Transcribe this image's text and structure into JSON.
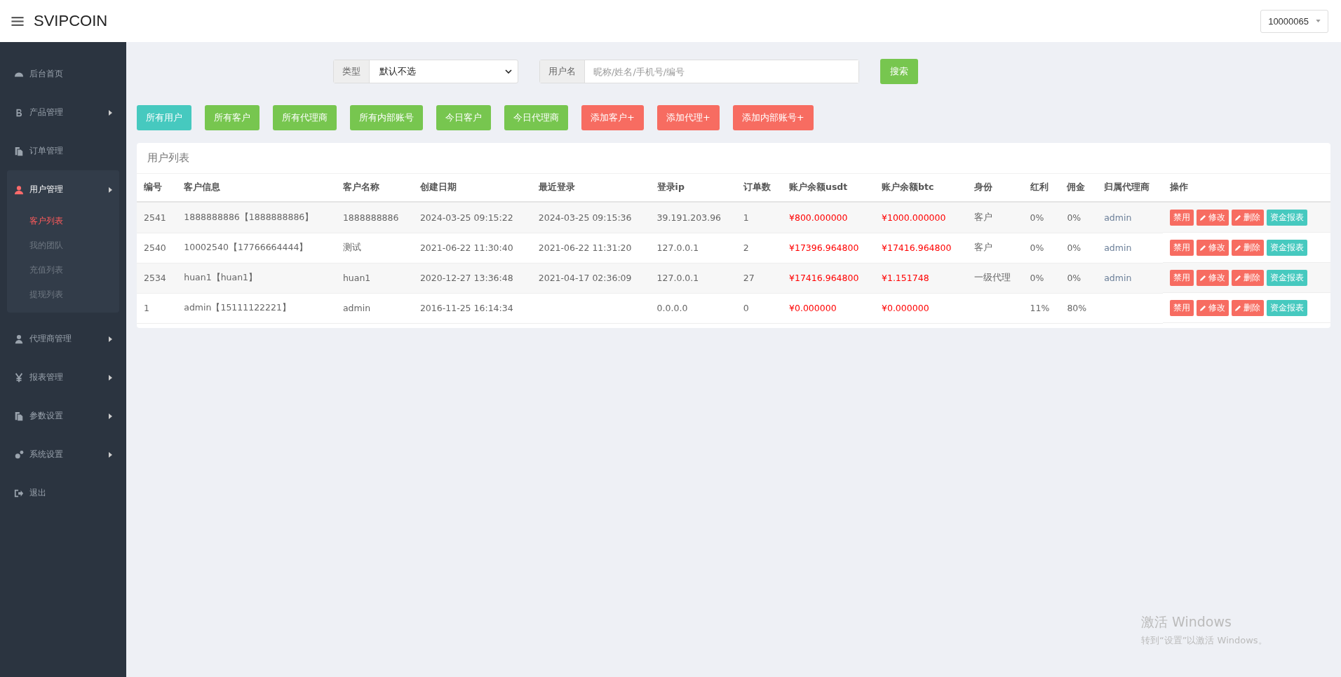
{
  "header": {
    "brand": "SVIPCOIN",
    "account": "10000065"
  },
  "sidebar": {
    "items": [
      {
        "label": "后台首页",
        "arrow": false,
        "selected": false
      },
      {
        "label": "产品管理",
        "arrow": true,
        "selected": false
      },
      {
        "label": "订单管理",
        "arrow": false,
        "selected": false
      },
      {
        "label": "用户管理",
        "arrow": true,
        "selected": true,
        "children": [
          {
            "label": "客户列表",
            "selected": true
          },
          {
            "label": "我的团队",
            "selected": false
          },
          {
            "label": "充值列表",
            "selected": false
          },
          {
            "label": "提现列表",
            "selected": false
          }
        ]
      },
      {
        "label": "代理商管理",
        "arrow": true,
        "selected": false
      },
      {
        "label": "报表管理",
        "arrow": true,
        "selected": false
      },
      {
        "label": "参数设置",
        "arrow": true,
        "selected": false
      },
      {
        "label": "系统设置",
        "arrow": true,
        "selected": false
      },
      {
        "label": "退出",
        "arrow": false,
        "selected": false
      }
    ]
  },
  "filters": {
    "type_label": "类型",
    "type_value": "默认不选",
    "name_label": "用户名",
    "name_placeholder": "昵称/姓名/手机号/编号",
    "search_button": "搜索"
  },
  "buttons": [
    {
      "kind": "filter",
      "label": "所有用户",
      "selected": true
    },
    {
      "kind": "filter",
      "label": "所有客户",
      "selected": false
    },
    {
      "kind": "filter",
      "label": "所有代理商",
      "selected": false
    },
    {
      "kind": "filter",
      "label": "所有内部账号",
      "selected": false
    },
    {
      "kind": "filter",
      "label": "今日客户",
      "selected": false
    },
    {
      "kind": "filter",
      "label": "今日代理商",
      "selected": false
    },
    {
      "kind": "add",
      "label": "添加客户+"
    },
    {
      "kind": "add",
      "label": "添加代理+"
    },
    {
      "kind": "add",
      "label": "添加内部账号+"
    }
  ],
  "table": {
    "title": "用户列表",
    "columns": [
      "编号",
      "客户信息",
      "客户名称",
      "创建日期",
      "最近登录",
      "登录ip",
      "订单数",
      "账户余额usdt",
      "账户余额btc",
      "身份",
      "红利",
      "佣金",
      "归属代理商",
      "操作"
    ],
    "rows": [
      {
        "cells": [
          "2541",
          "1888888886【1888888886】",
          "1888888886",
          "2024-03-25 09:15:22",
          "2024-03-25 09:15:36",
          "39.191.203.96",
          "1",
          "¥800.000000",
          "¥1000.000000",
          "客户",
          "0%",
          "0%",
          "admin"
        ],
        "actions": [
          {
            "kind": "ban",
            "label": "禁用"
          },
          {
            "kind": "edit",
            "label": "修改"
          },
          {
            "kind": "delete",
            "label": "删除"
          },
          {
            "kind": "report",
            "label": "资金报表"
          }
        ]
      },
      {
        "cells": [
          "2540",
          "10002540【17766664444】",
          "测试",
          "2021-06-22 11:30:40",
          "2021-06-22 11:31:20",
          "127.0.0.1",
          "2",
          "¥17396.964800",
          "¥17416.964800",
          "客户",
          "0%",
          "0%",
          "admin"
        ],
        "actions": [
          {
            "kind": "ban",
            "label": "禁用"
          },
          {
            "kind": "edit",
            "label": "修改"
          },
          {
            "kind": "delete",
            "label": "删除"
          },
          {
            "kind": "report",
            "label": "资金报表"
          }
        ]
      },
      {
        "cells": [
          "2534",
          "huan1【huan1】",
          "huan1",
          "2020-12-27 13:36:48",
          "2021-04-17 02:36:09",
          "127.0.0.1",
          "27",
          "¥17416.964800",
          "¥1.151748",
          "一级代理",
          "0%",
          "0%",
          "admin"
        ],
        "actions": [
          {
            "kind": "ban",
            "label": "禁用"
          },
          {
            "kind": "edit",
            "label": "修改"
          },
          {
            "kind": "delete",
            "label": "删除"
          },
          {
            "kind": "report",
            "label": "资金报表"
          }
        ]
      },
      {
        "cells": [
          "1",
          "admin【15111122221】",
          "admin",
          "2016-11-25 16:14:34",
          "",
          "0.0.0.0",
          "0",
          "¥0.000000",
          "¥0.000000",
          "",
          "11%",
          "80%",
          ""
        ],
        "actions": [
          {
            "kind": "ban",
            "label": "禁用"
          },
          {
            "kind": "edit",
            "label": "修改"
          },
          {
            "kind": "delete",
            "label": "删除"
          },
          {
            "kind": "report",
            "label": "资金报表"
          }
        ]
      }
    ]
  },
  "os_notice": {
    "title": "激活 Windows",
    "text": "转到“设置”以激活 Windows。"
  }
}
